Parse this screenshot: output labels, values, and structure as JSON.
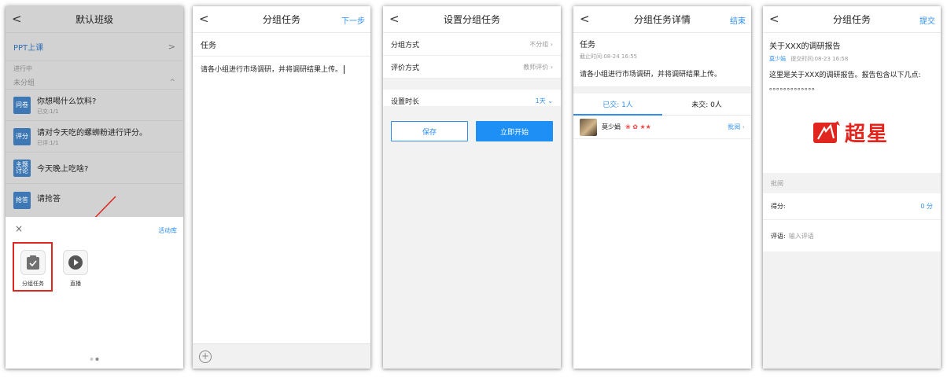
{
  "screen1": {
    "title": "默认班级",
    "back": "<",
    "ppt": "PPT上课",
    "ppt_arrow": ">",
    "section_ongoing": "进行中",
    "section_ungrouped": "未分组",
    "section_chevron": "^",
    "activities": [
      {
        "tag": "问卷",
        "title": "你想喝什么饮料?",
        "sub": "已交:1/1"
      },
      {
        "tag": "评分",
        "title": "请对今天吃的螺蛳粉进行评分。",
        "sub": "已评:1/1"
      },
      {
        "tag": "主题\n讨论",
        "title": "今天晚上吃啥?",
        "sub": ""
      },
      {
        "tag": "抢答",
        "title": "请抢答",
        "sub": ""
      }
    ],
    "sheet": {
      "close": "×",
      "library": "活动库",
      "tools": [
        "分组任务",
        "直播"
      ],
      "page_dots": 2,
      "active_dot": 1
    },
    "highlight_color": "#e0261e"
  },
  "screen2": {
    "title": "分组任务",
    "back": "<",
    "next": "下一步",
    "field_label": "任务",
    "content": "请各小组进行市场调研，并将调研结果上传。",
    "plus": "+"
  },
  "screen3": {
    "title": "设置分组任务",
    "back": "<",
    "options": [
      {
        "label": "分组方式",
        "value": "不分组"
      },
      {
        "label": "评价方式",
        "value": "教师评价"
      }
    ],
    "duration_label": "设置时长",
    "duration_value": "1天",
    "save": "保存",
    "start": "立即开始"
  },
  "screen4": {
    "title": "分组任务详情",
    "back": "<",
    "end": "结束",
    "task_label": "任务",
    "deadline": "截止时间:08-24 16:55",
    "content": "请各小组进行市场调研，并将调研结果上传。",
    "tab_submitted": "已交: 1人",
    "tab_unsubmitted": "未交: 0人",
    "student_name": "莫少娟",
    "student_badges": "❀ ✿ ★★",
    "review": "批阅"
  },
  "screen5": {
    "title": "分组任务",
    "back": "<",
    "submit": "提交",
    "report_title": "关于XXX的调研报告",
    "author": "莫少娟",
    "submit_time": "提交时间:08-23 16:58",
    "body": "这里是关于XXX的调研报告。报告包含以下几点: 。。。。。。。。。。。。。",
    "logo_text": "超星",
    "section_review": "批阅",
    "score_label": "得分:",
    "score_value": "0 分",
    "comment_label": "评语:",
    "comment_placeholder": "输入评语"
  },
  "colors": {
    "accent": "#2e8ff0",
    "tag_blue": "#3d78b5",
    "logo_red": "#e0261e"
  }
}
